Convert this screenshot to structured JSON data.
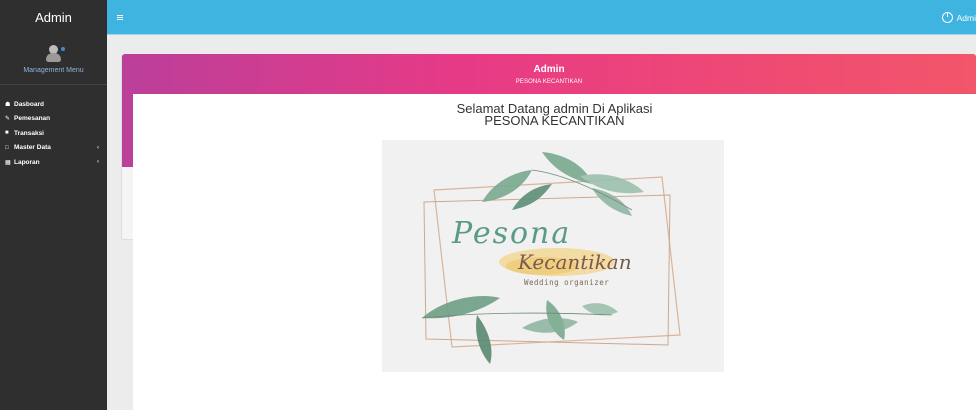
{
  "sidebar": {
    "brand": "Admin",
    "user_caption": "Management Menu",
    "items": [
      {
        "icon": "home-icon",
        "label": "Dasboard",
        "caret": ""
      },
      {
        "icon": "pencil-icon",
        "label": "Pemesanan",
        "caret": ""
      },
      {
        "icon": "document-icon",
        "label": "Transaksi",
        "caret": ""
      },
      {
        "icon": "edit-icon",
        "label": "Master Data",
        "caret": "‹"
      },
      {
        "icon": "calendar-icon",
        "label": "Laporan",
        "caret": "‹"
      }
    ]
  },
  "topbar": {
    "user_label": "Admi"
  },
  "hero": {
    "title": "Admin",
    "subtitle": "PESONA KECANTIKAN"
  },
  "panel": {
    "welcome_line1": "Selamat Datang admin Di Aplikasi",
    "welcome_line2": "PESONA KECANTIKAN"
  },
  "logo": {
    "line1": "Pesona",
    "line2": "Kecantikan",
    "line3": "Wedding organizer"
  },
  "colors": {
    "sidebar_bg": "#2f2f2f",
    "topbar_bg": "#3fb4e0",
    "hero_gradient_start": "#bb3f9a",
    "hero_gradient_end": "#f2566a"
  }
}
